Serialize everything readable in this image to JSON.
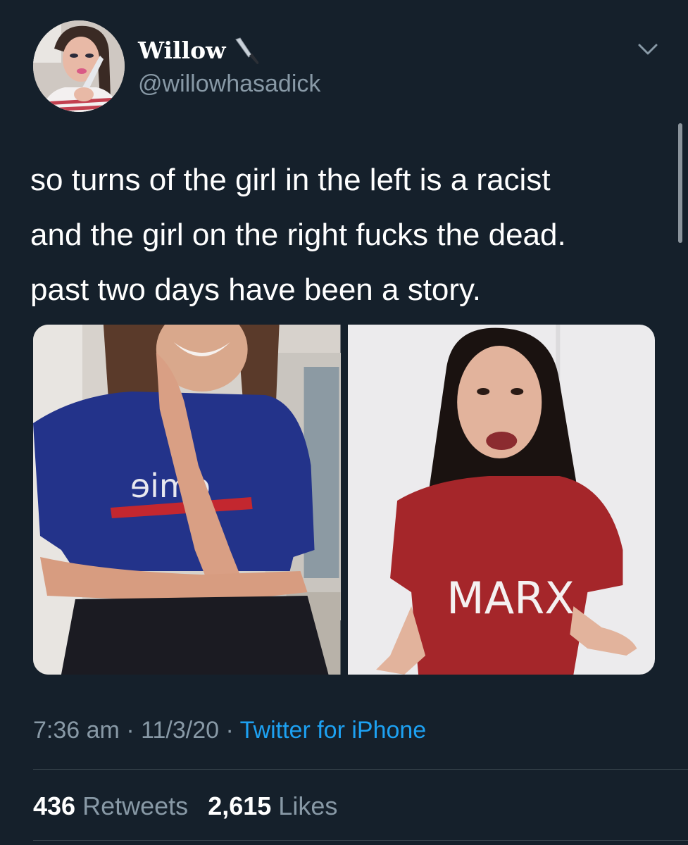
{
  "tweet": {
    "author": {
      "display_name": "Willow",
      "name_emoji": "knife-emoji",
      "handle": "@willowhasadick",
      "avatar": "profile-photo"
    },
    "text": "so turns of the girl in the left is a racist\nand the girl on the right fucks the dead.\npast two days have been a story.",
    "media": {
      "left_image": {
        "shirt_text": "ɘimɘ"
      },
      "right_image": {
        "shirt_text": "MARX"
      }
    },
    "meta": {
      "time": "7:36 am",
      "separator": "·",
      "date": "11/3/20",
      "source": "Twitter for iPhone"
    },
    "stats": {
      "retweets_count": "436",
      "retweets_label": "Retweets",
      "likes_count": "2,615",
      "likes_label": "Likes"
    }
  },
  "colors": {
    "background": "#15202b",
    "primary_text": "#ffffff",
    "secondary_text": "#8899a6",
    "link": "#1da1f2",
    "divider": "#38444d"
  },
  "icons": {
    "more": "chevron-down-icon"
  }
}
